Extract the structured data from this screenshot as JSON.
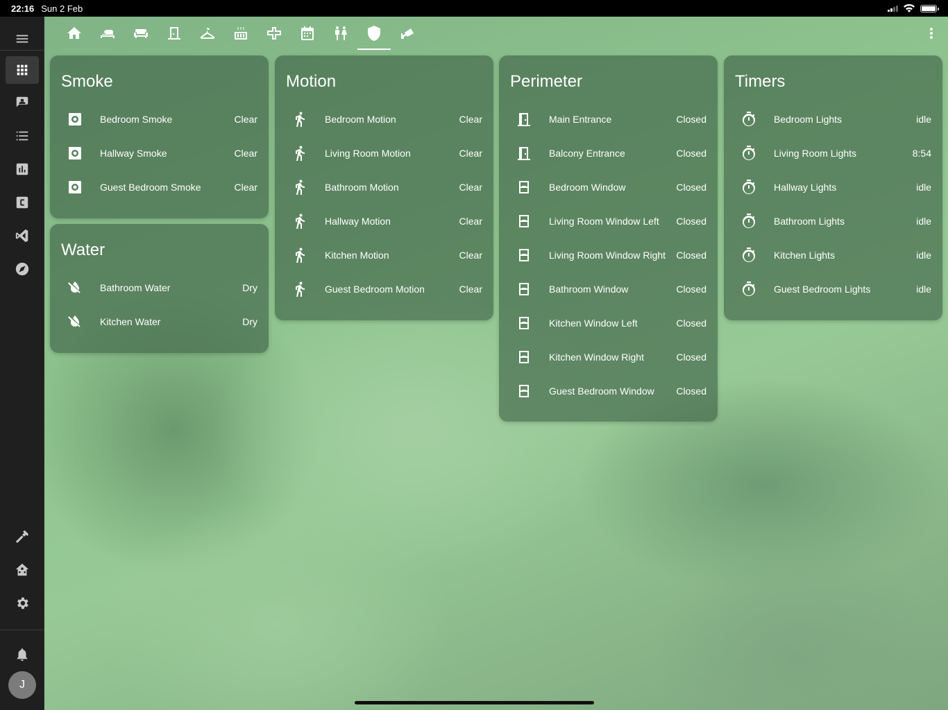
{
  "status_bar": {
    "time": "22:16",
    "date": "Sun 2 Feb"
  },
  "sidebar": {
    "items": [
      {
        "name": "overview",
        "icon": "grid-icon",
        "active": true
      },
      {
        "name": "map",
        "icon": "account-box-icon"
      },
      {
        "name": "logbook",
        "icon": "list-icon"
      },
      {
        "name": "history",
        "icon": "chart-icon"
      },
      {
        "name": "configurator",
        "icon": "c-box-icon"
      },
      {
        "name": "vscode",
        "icon": "vscode-icon"
      },
      {
        "name": "media",
        "icon": "compass-icon"
      }
    ],
    "bottom_items": [
      {
        "name": "developer-tools",
        "icon": "hammer-icon"
      },
      {
        "name": "supervisor",
        "icon": "home-assistant-icon"
      },
      {
        "name": "settings",
        "icon": "gear-icon"
      }
    ],
    "notifications": {
      "icon": "bell-icon"
    },
    "user_initial": "J"
  },
  "tabs": [
    {
      "icon": "home-icon"
    },
    {
      "icon": "bed-icon"
    },
    {
      "icon": "sofa-icon"
    },
    {
      "icon": "door-icon"
    },
    {
      "icon": "hanger-icon"
    },
    {
      "icon": "stove-icon"
    },
    {
      "icon": "hallway-icon"
    },
    {
      "icon": "calendar-icon"
    },
    {
      "icon": "people-icon"
    },
    {
      "icon": "shield-icon",
      "active": true
    },
    {
      "icon": "cctv-icon"
    }
  ],
  "cards": {
    "smoke": {
      "title": "Smoke",
      "rows": [
        {
          "name": "Bedroom Smoke",
          "state": "Clear",
          "icon": "smoke-detector-icon"
        },
        {
          "name": "Hallway Smoke",
          "state": "Clear",
          "icon": "smoke-detector-icon"
        },
        {
          "name": "Guest Bedroom Smoke",
          "state": "Clear",
          "icon": "smoke-detector-icon"
        }
      ]
    },
    "water": {
      "title": "Water",
      "rows": [
        {
          "name": "Bathroom Water",
          "state": "Dry",
          "icon": "water-off-icon"
        },
        {
          "name": "Kitchen Water",
          "state": "Dry",
          "icon": "water-off-icon"
        }
      ]
    },
    "motion": {
      "title": "Motion",
      "rows": [
        {
          "name": "Bedroom Motion",
          "state": "Clear",
          "icon": "walk-icon"
        },
        {
          "name": "Living Room Motion",
          "state": "Clear",
          "icon": "walk-icon"
        },
        {
          "name": "Bathroom Motion",
          "state": "Clear",
          "icon": "walk-icon"
        },
        {
          "name": "Hallway Motion",
          "state": "Clear",
          "icon": "walk-icon"
        },
        {
          "name": "Kitchen Motion",
          "state": "Clear",
          "icon": "walk-icon"
        },
        {
          "name": "Guest Bedroom Motion",
          "state": "Clear",
          "icon": "walk-icon"
        }
      ]
    },
    "perimeter": {
      "title": "Perimeter",
      "rows": [
        {
          "name": "Main Entrance",
          "state": "Closed",
          "icon": "door-closed-icon"
        },
        {
          "name": "Balcony Entrance",
          "state": "Closed",
          "icon": "door-closed-icon"
        },
        {
          "name": "Bedroom Window",
          "state": "Closed",
          "icon": "window-closed-icon"
        },
        {
          "name": "Living Room Window Left",
          "state": "Closed",
          "icon": "window-closed-icon"
        },
        {
          "name": "Living Room Window Right",
          "state": "Closed",
          "icon": "window-closed-icon"
        },
        {
          "name": "Bathroom Window",
          "state": "Closed",
          "icon": "window-closed-icon"
        },
        {
          "name": "Kitchen Window Left",
          "state": "Closed",
          "icon": "window-closed-icon"
        },
        {
          "name": "Kitchen Window Right",
          "state": "Closed",
          "icon": "window-closed-icon"
        },
        {
          "name": "Guest Bedroom Window",
          "state": "Closed",
          "icon": "window-closed-icon"
        }
      ]
    },
    "timers": {
      "title": "Timers",
      "rows": [
        {
          "name": "Bedroom Lights",
          "state": "idle",
          "icon": "timer-icon"
        },
        {
          "name": "Living Room Lights",
          "state": "8:54",
          "icon": "timer-icon"
        },
        {
          "name": "Hallway Lights",
          "state": "idle",
          "icon": "timer-icon"
        },
        {
          "name": "Bathroom Lights",
          "state": "idle",
          "icon": "timer-icon"
        },
        {
          "name": "Kitchen Lights",
          "state": "idle",
          "icon": "timer-icon"
        },
        {
          "name": "Guest Bedroom Lights",
          "state": "idle",
          "icon": "timer-icon"
        }
      ]
    }
  }
}
